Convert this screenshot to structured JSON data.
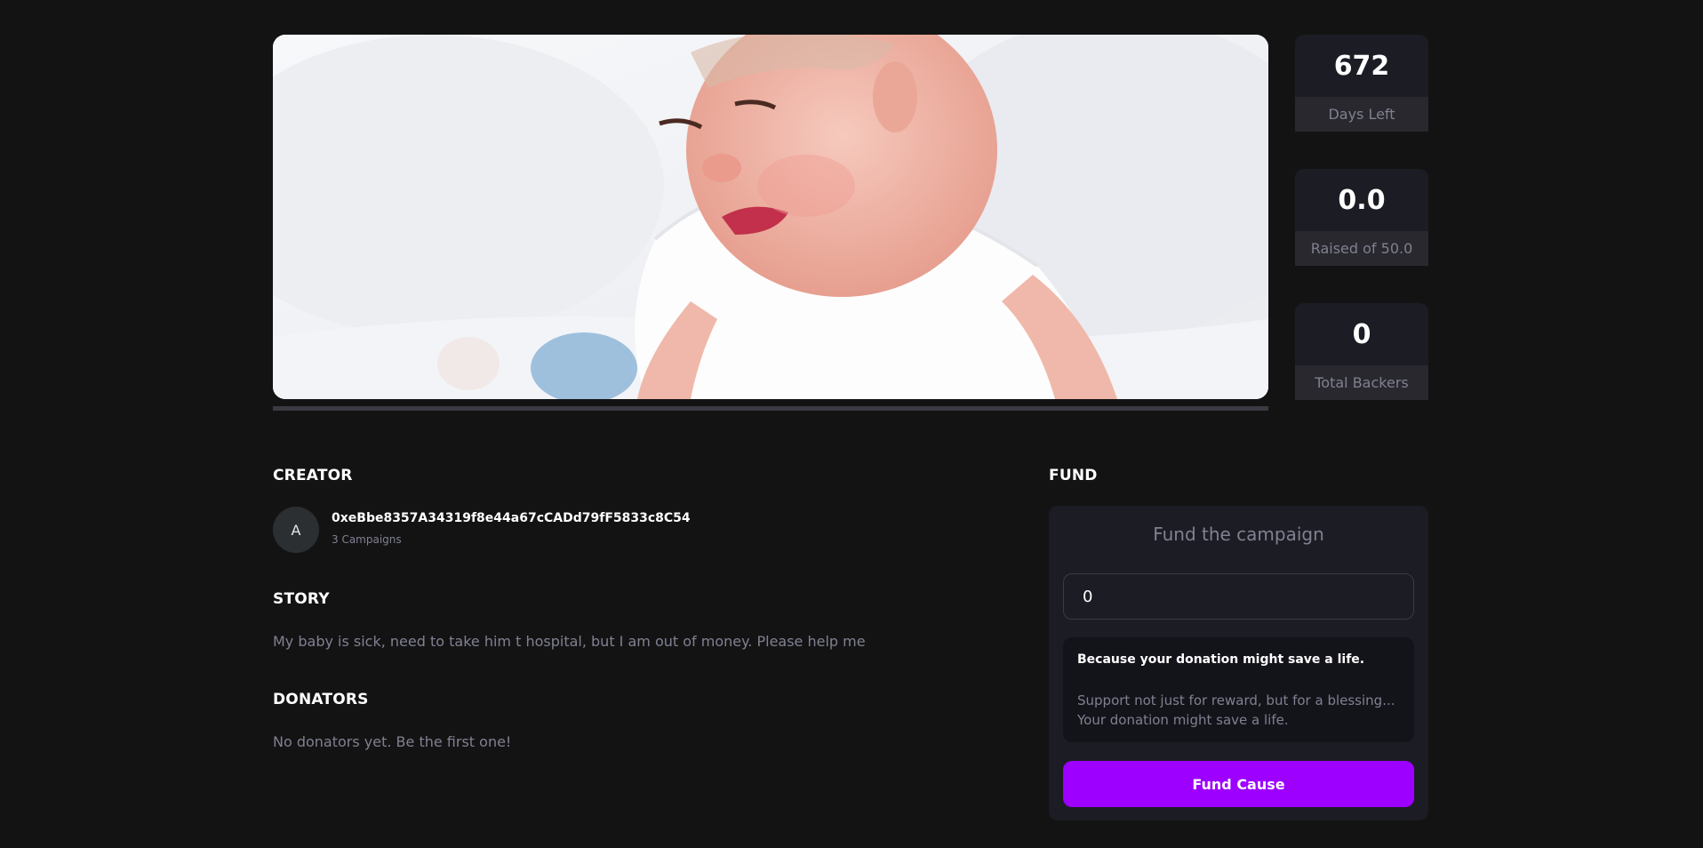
{
  "campaign": {
    "image_alt": "Crying baby lying on a white bed",
    "progress_fraction": 0.0
  },
  "stats": [
    {
      "value": "672",
      "label": "Days Left"
    },
    {
      "value": "0.0",
      "label": "Raised of 50.0"
    },
    {
      "value": "0",
      "label": "Total Backers"
    }
  ],
  "creator": {
    "section_title": "CREATOR",
    "avatar_letter": "A",
    "address": "0xeBbe8357A34319f8e44a67cCADd79fF5833c8C54",
    "campaigns": "3 Campaigns"
  },
  "story": {
    "section_title": "STORY",
    "text": "My baby is sick, need to take him t hospital, but I am out of money. Please help me"
  },
  "donators": {
    "section_title": "DONATORS",
    "empty_text": "No donators yet. Be the first one!"
  },
  "fund": {
    "section_title": "FUND",
    "heading": "Fund the campaign",
    "amount_value": "0",
    "note_title": "Because your donation might save a life.",
    "note_text": "Support not just for reward, but for a blessing... Your donation might save a life.",
    "button_label": "Fund Cause"
  },
  "colors": {
    "background": "#131314",
    "card": "#1c1c24",
    "accent": "#9d00ff",
    "muted_text": "#808191",
    "progress": "#4acd8d"
  }
}
